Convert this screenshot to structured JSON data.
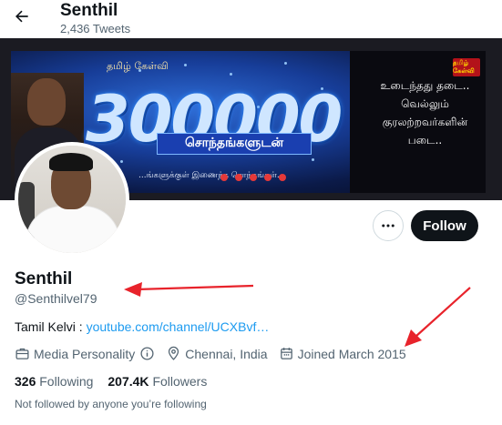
{
  "header": {
    "back_icon": "arrow-left-icon",
    "name": "Senthil",
    "tweet_count": "2,436 Tweets"
  },
  "banner": {
    "top_text": "தமிழ் கேள்வி",
    "big_number": "300000",
    "band_text": "சொந்தங்களுடன்",
    "sub_text": "...ங்களுக்குள் இணைந்த சொந்தங்கள்...",
    "right_text": "உடைந்தது தடை.. வெல்லும் குரலற்றவர்களின் படை..",
    "logo_text": "தமிழ் கேள்வி"
  },
  "actions": {
    "more_icon": "more-horizontal-icon",
    "follow_label": "Follow"
  },
  "profile": {
    "name": "Senthil",
    "handle": "@Senthilvel79",
    "bio_prefix": "Tamil Kelvi : ",
    "bio_link": "youtube.com/channel/UCXBvf…",
    "category": "Media Personality",
    "location": "Chennai, India",
    "joined": "Joined March 2015",
    "following_count": "326",
    "following_label": "Following",
    "followers_count": "207.4K",
    "followers_label": "Followers",
    "not_followed": "Not followed by anyone you’re following"
  },
  "colors": {
    "link": "#1d9bf0",
    "secondary_text": "#536471",
    "primary_text": "#0f1419",
    "annotation_red": "#e8232b"
  }
}
